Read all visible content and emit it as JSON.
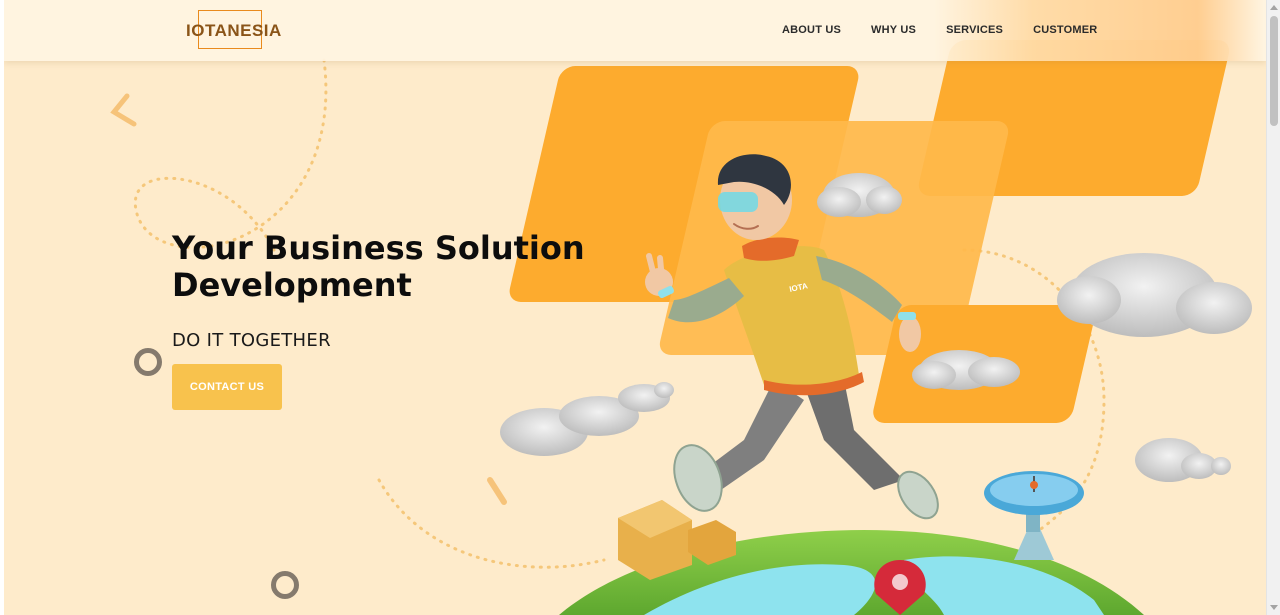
{
  "navbar": {
    "logo_text": "IOTANESIA",
    "links": [
      "ABOUT US",
      "WHY US",
      "SERVICES",
      "CUSTOMER"
    ]
  },
  "hero": {
    "title_line1": "Your Business Solution",
    "title_line2": "Development",
    "subtitle": "DO IT TOGETHER",
    "cta_label": "CONTACT US",
    "badge_text": "IOTA"
  },
  "colors": {
    "background": "#feebcb",
    "accent_orange": "#fdab2e",
    "cta_yellow": "#f8c24d",
    "logo_brown": "#8a5418"
  }
}
